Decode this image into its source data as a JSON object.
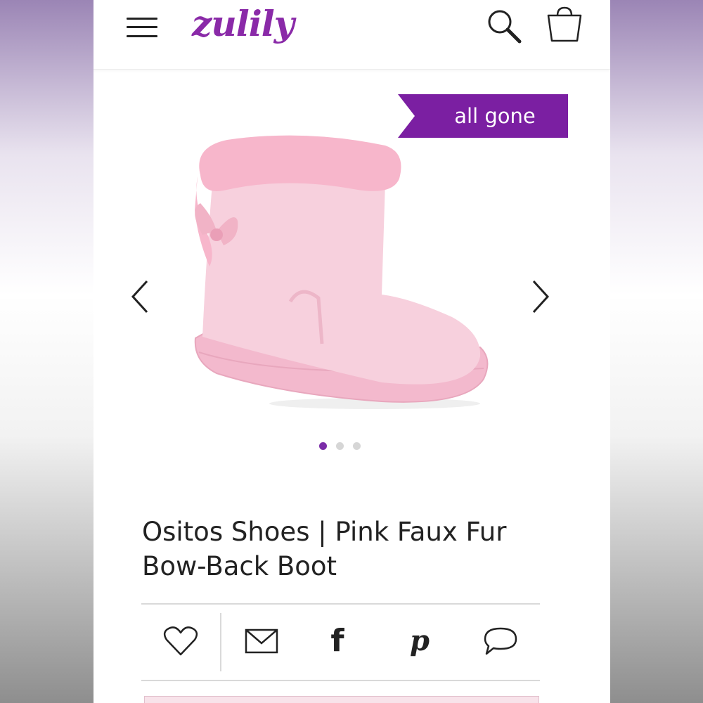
{
  "header": {
    "logo_text": "zulily",
    "menu_icon": "hamburger-icon",
    "search_icon": "magnifier-icon",
    "bag_icon": "shopping-bag-icon"
  },
  "product": {
    "badge": "all gone",
    "title": "Ositos Shoes | Pink Faux Fur Bow-Back Boot",
    "image_alt": "pink faux fur bow-back boot",
    "carousel": {
      "count": 3,
      "active": 1
    }
  },
  "social": [
    "heart-icon",
    "email-icon",
    "facebook-icon",
    "pinterest-icon",
    "comment-icon"
  ],
  "colors": {
    "brand_purple": "#8a2aa8",
    "badge_purple": "#7b1fa2",
    "boot_pink": "#f4c9d8"
  }
}
